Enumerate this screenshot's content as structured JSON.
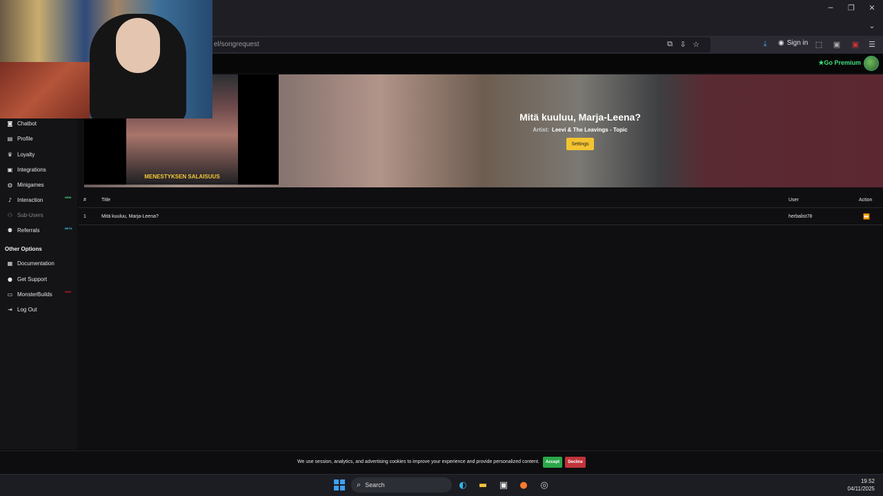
{
  "browser": {
    "url_visible": "el/songrequest",
    "sign_in_label": "Sign in",
    "window_controls": [
      "minimize-icon",
      "restore-icon",
      "close-icon"
    ]
  },
  "header": {
    "go_premium_label": "Go Premium",
    "accent_color": "#3fe07a"
  },
  "sidebar": {
    "items": [
      {
        "label": "Chatbot",
        "icon": "chat-icon"
      },
      {
        "label": "Profile",
        "icon": "profile-icon"
      },
      {
        "label": "Loyalty",
        "icon": "trophy-icon"
      },
      {
        "label": "Integrations",
        "icon": "integrations-icon"
      },
      {
        "label": "Minigames",
        "icon": "gamepad-icon"
      },
      {
        "label": "Interaction",
        "icon": "music-icon",
        "tag": "NEW"
      },
      {
        "label": "Sub-Users",
        "icon": "subusers-icon"
      },
      {
        "label": "Referrals",
        "icon": "referrals-icon",
        "tag": "BETA"
      }
    ],
    "other_options_title": "Other Options",
    "other_items": [
      {
        "label": "Documentation",
        "icon": "doc-icon"
      },
      {
        "label": "Get Support",
        "icon": "support-icon"
      },
      {
        "label": "MonsterBuilds",
        "icon": "laptop-icon",
        "tag": "NEW"
      },
      {
        "label": "Log Out",
        "icon": "logout-icon"
      }
    ]
  },
  "now_playing": {
    "video_caption": "MENESTYKSEN SALAISUUS",
    "title": "Mitä kuuluu, Marja-Leena?",
    "artist_label": "Artist:",
    "artist": "Leevi & The Leavings - Topic",
    "settings_label": "Settings",
    "settings_color": "#f4c430"
  },
  "queue": {
    "columns": [
      "#",
      "Title",
      "User",
      "Action"
    ],
    "rows": [
      {
        "index": "1",
        "title": "Mitä kuuluu, Marja-Leena?",
        "user": "herbalist78"
      }
    ]
  },
  "cookie": {
    "text": "We use session, analytics, and advertising cookies to improve your experience and provide personalized content.",
    "accept_label": "Accept",
    "decline_label": "Decline"
  },
  "taskbar": {
    "search_label": "Search",
    "time": "19.52",
    "date": "04/11/2025"
  }
}
